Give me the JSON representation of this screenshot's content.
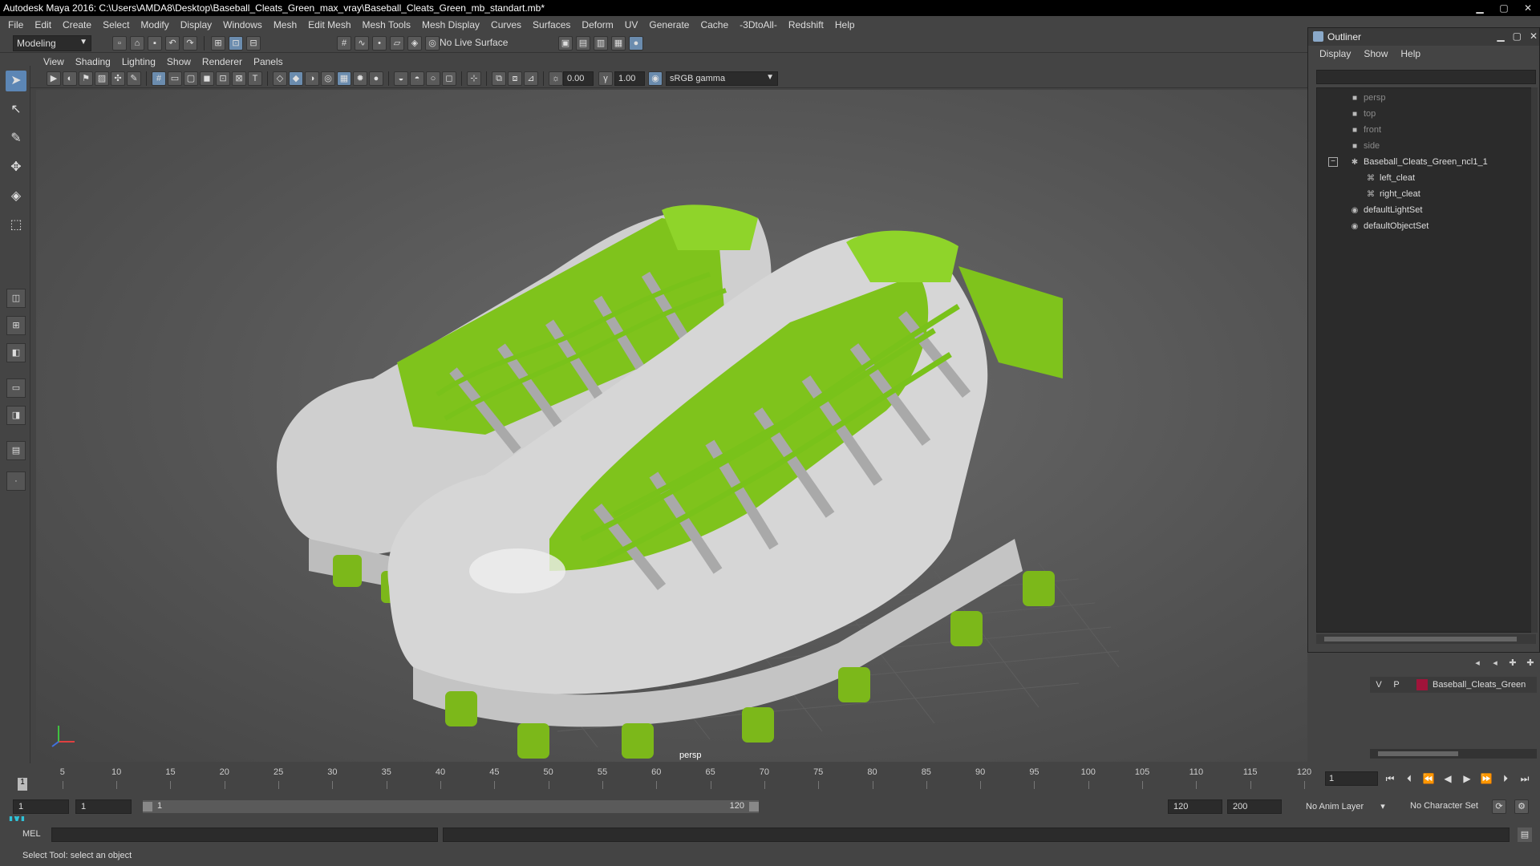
{
  "window": {
    "title": "Autodesk Maya 2016: C:\\Users\\AMDA8\\Desktop\\Baseball_Cleats_Green_max_vray\\Baseball_Cleats_Green_mb_standart.mb*",
    "controls": [
      "minimize-icon",
      "maximize-icon",
      "close-icon"
    ]
  },
  "menu": [
    "File",
    "Edit",
    "Create",
    "Select",
    "Modify",
    "Display",
    "Windows",
    "Mesh",
    "Edit Mesh",
    "Mesh Tools",
    "Mesh Display",
    "Curves",
    "Surfaces",
    "Deform",
    "UV",
    "Generate",
    "Cache",
    "-3DtoAll-",
    "Redshift",
    "Help"
  ],
  "shelf": {
    "mode": "Modeling",
    "live_surface": "No Live Surface"
  },
  "panel": {
    "menu": [
      "View",
      "Shading",
      "Lighting",
      "Show",
      "Renderer",
      "Panels"
    ],
    "exposure": "0.00",
    "gamma": "1.00",
    "color_space": "sRGB gamma",
    "camera_label": "persp"
  },
  "outliner": {
    "title": "Outliner",
    "menu": [
      "Display",
      "Show",
      "Help"
    ],
    "items": [
      {
        "label": "persp",
        "icon": "camera-icon",
        "dim": true
      },
      {
        "label": "top",
        "icon": "camera-icon",
        "dim": true
      },
      {
        "label": "front",
        "icon": "camera-icon",
        "dim": true
      },
      {
        "label": "side",
        "icon": "camera-icon",
        "dim": true
      },
      {
        "label": "Baseball_Cleats_Green_ncl1_1",
        "icon": "group-icon",
        "dim": false
      },
      {
        "label": "left_cleat",
        "icon": "mesh-icon",
        "dim": false
      },
      {
        "label": "right_cleat",
        "icon": "mesh-icon",
        "dim": false
      },
      {
        "label": "defaultLightSet",
        "icon": "set-icon",
        "dim": false
      },
      {
        "label": "defaultObjectSet",
        "icon": "set-icon",
        "dim": false
      }
    ]
  },
  "layers": {
    "visible": "V",
    "playback": "P",
    "name": "Baseball_Cleats_Green",
    "color": "#a0143a"
  },
  "timeline": {
    "ticks": [
      "5",
      "10",
      "15",
      "20",
      "25",
      "30",
      "35",
      "40",
      "45",
      "50",
      "55",
      "60",
      "65",
      "70",
      "75",
      "80",
      "85",
      "90",
      "95",
      "100",
      "105",
      "110",
      "115",
      "120"
    ],
    "current_frame": "1",
    "frame_field": "1"
  },
  "range": {
    "start": "1",
    "playback_start": "1",
    "slider_start": "1",
    "slider_end": "120",
    "playback_end": "120",
    "end": "200",
    "anim_layer": "No Anim Layer",
    "character_set": "No Character Set"
  },
  "command": {
    "label": "MEL"
  },
  "status": {
    "help_line": "Select Tool: select an object"
  },
  "colors": {
    "accent_green": "#7fc31c",
    "cleat_white": "#d6d6d6",
    "selection_blue": "#5c86b5"
  }
}
